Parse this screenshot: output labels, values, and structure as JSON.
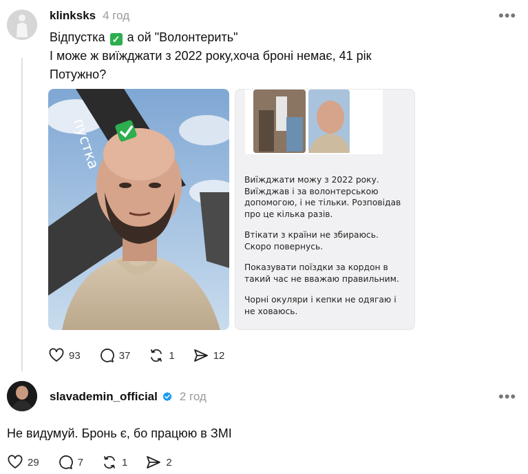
{
  "post": {
    "username": "klinksks",
    "time": "4 год",
    "line1_a": "Відпустка",
    "line1_check": "✓",
    "line1_b": "а ой \"Волонтерить\"",
    "line2": "І може ж виїжджати з 2022 року,хоча броні немає, 41 рік",
    "line3": "Потужно?",
    "photo_caption": "пустка",
    "story": {
      "p1": "Виїжджати можу з 2022 року. Виїжджав і за волонтерською допомогою, і не тільки. Розповідав про це кілька разів.",
      "p2": "Втікати з країни не збираюсь. Скоро повернусь.",
      "p3": "Показувати поїздки за кордон в такий час не вважаю правильним.",
      "p4": "Чорні окуляри і кепки не одягаю і не ховаюсь."
    },
    "likes": "93",
    "comments": "37",
    "reposts": "1",
    "shares": "12"
  },
  "reply": {
    "username": "slavademin_official",
    "time": "2 год",
    "text": "Не видумуй. Бронь є, бо працюю в ЗМІ",
    "likes": "29",
    "comments": "7",
    "reposts": "1",
    "shares": "2"
  },
  "icons": {
    "like": "heart-icon",
    "comment": "comment-bubble-icon",
    "repost": "repost-icon",
    "share": "send-icon",
    "more": "more-dots-icon",
    "verified": "verified-badge-icon"
  },
  "colors": {
    "verified": "#1d9bf0",
    "check": "#2eae4f",
    "muted": "#9a9a9a"
  }
}
